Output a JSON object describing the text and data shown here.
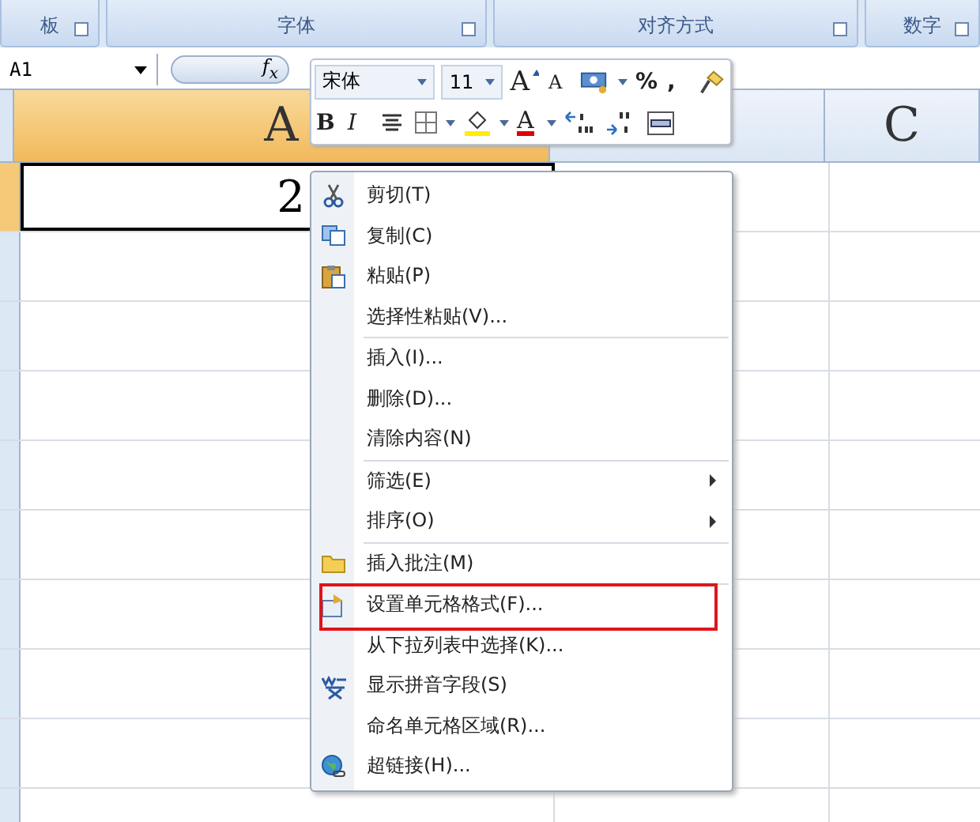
{
  "ribbon_groups": [
    {
      "label": "板"
    },
    {
      "label": "字体"
    },
    {
      "label": "对齐方式"
    },
    {
      "label": "数字"
    }
  ],
  "name_box": "A1",
  "formula_button": "f$_{x}$",
  "columns": [
    {
      "label": "A",
      "selected": true
    },
    {
      "selected": false
    },
    {
      "label": "C",
      "selected": false
    }
  ],
  "rows": [
    {
      "selected": true,
      "cell_a": "2"
    },
    {
      "selected": false
    },
    {
      "selected": false
    },
    {
      "selected": false
    },
    {
      "selected": false
    },
    {
      "selected": false
    },
    {
      "selected": false
    },
    {
      "selected": false
    },
    {
      "selected": false
    },
    {
      "selected": false
    }
  ],
  "mini_toolbar": {
    "font": "宋体",
    "size": "11",
    "row_1": [
      {
        "kind": "grow",
        "label": "A"
      },
      {
        "kind": "shrink",
        "label": "A"
      },
      {
        "kind": "accounting",
        "dropdown": true
      },
      {
        "kind": "text",
        "label": "%"
      },
      {
        "kind": "text",
        "label": ","
      },
      {
        "kind": "painter"
      }
    ],
    "row_2": [
      {
        "kind": "bold",
        "label": "B"
      },
      {
        "kind": "italic",
        "label": "I"
      },
      {
        "kind": "center"
      },
      {
        "kind": "borders",
        "dropdown": true
      },
      {
        "kind": "fill",
        "dropdown": true
      },
      {
        "kind": "fontcolor",
        "label": "A",
        "dropdown": true
      },
      {
        "kind": "incdec"
      },
      {
        "kind": "decdec"
      },
      {
        "kind": "merge"
      }
    ]
  },
  "context_menu": [
    {
      "kind": "cut",
      "label": "剪切(T)"
    },
    {
      "kind": "copy",
      "label": "复制(C)"
    },
    {
      "kind": "paste",
      "label": "粘贴(P)"
    },
    {
      "kind": "item",
      "label": "选择性粘贴(V)..."
    },
    {
      "kind": "separator"
    },
    {
      "kind": "item",
      "label": "插入(I)..."
    },
    {
      "kind": "item",
      "label": "删除(D)..."
    },
    {
      "kind": "item",
      "label": "清除内容(N)"
    },
    {
      "kind": "separator"
    },
    {
      "kind": "item",
      "label": "筛选(E)",
      "submenu": true
    },
    {
      "kind": "item",
      "label": "排序(O)",
      "submenu": true
    },
    {
      "kind": "separator"
    },
    {
      "kind": "comment",
      "label": "插入批注(M)"
    },
    {
      "kind": "separator"
    },
    {
      "kind": "format",
      "label": "设置单元格格式(F)...",
      "marked": true
    },
    {
      "kind": "item",
      "label": "从下拉列表中选择(K)..."
    },
    {
      "kind": "pinyin",
      "label": "显示拼音字段(S)"
    },
    {
      "kind": "item",
      "label": "命名单元格区域(R)..."
    },
    {
      "kind": "hyperlink",
      "label": "超链接(H)..."
    }
  ]
}
